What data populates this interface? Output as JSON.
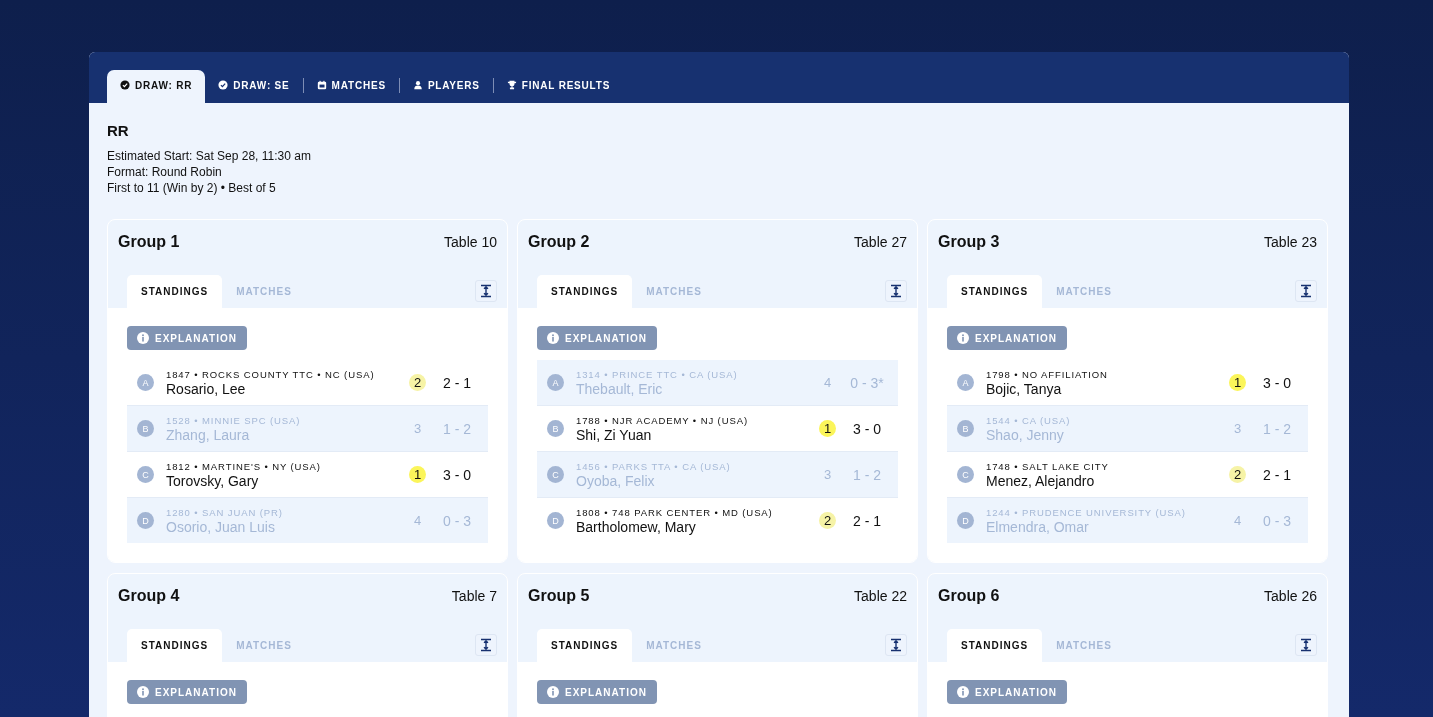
{
  "tabs": [
    {
      "label": "DRAW: RR",
      "selected": true
    },
    {
      "label": "DRAW: SE",
      "selected": false
    },
    {
      "label": "MATCHES",
      "selected": false
    },
    {
      "label": "PLAYERS",
      "selected": false
    },
    {
      "label": "FINAL RESULTS",
      "selected": false
    }
  ],
  "event": {
    "title": "RR",
    "lines": [
      "Estimated Start: Sat Sep 28, 11:30 am",
      "Format: Round Robin",
      "First to 11 (Win by 2) • Best of 5"
    ]
  },
  "groups": [
    {
      "name": "Group 1",
      "table": "Table 10",
      "tabs": [
        {
          "label": "STANDINGS",
          "selected": true
        },
        {
          "label": "MATCHES",
          "selected": false
        }
      ],
      "explanation": "EXPLANATION",
      "players": [
        {
          "seed": "A",
          "info": "1847 • ROCKS COUNTY TTC • NC (USA)",
          "name": "Rosario, Lee",
          "rank": "2",
          "record": "2 - 1",
          "advancing": true,
          "color": "#f6f3a6"
        },
        {
          "seed": "B",
          "info": "1528 • MINNIE SPC (USA)",
          "name": "Zhang, Laura",
          "rank": "3",
          "record": "1 - 2",
          "advancing": false
        },
        {
          "seed": "C",
          "info": "1812 • MARTINE'S • NY (USA)",
          "name": "Torovsky, Gary",
          "rank": "1",
          "record": "3 - 0",
          "advancing": true,
          "color": "#fbf55a"
        },
        {
          "seed": "D",
          "info": "1280 • SAN JUAN (PR)",
          "name": "Osorio, Juan Luis",
          "rank": "4",
          "record": "0 - 3",
          "advancing": false
        }
      ]
    },
    {
      "name": "Group 2",
      "table": "Table 27",
      "tabs": [
        {
          "label": "STANDINGS",
          "selected": true
        },
        {
          "label": "MATCHES",
          "selected": false
        }
      ],
      "explanation": "EXPLANATION",
      "players": [
        {
          "seed": "A",
          "info": "1314 • PRINCE TTC • CA (USA)",
          "name": "Thebault, Eric",
          "rank": "4",
          "record": "0 - 3*",
          "advancing": false
        },
        {
          "seed": "B",
          "info": "1788 • NJR ACADEMY • NJ (USA)",
          "name": "Shi, Zi Yuan",
          "rank": "1",
          "record": "3 - 0",
          "advancing": true,
          "color": "#fbf55a"
        },
        {
          "seed": "C",
          "info": "1456 • PARKS TTA • CA (USA)",
          "name": "Oyoba, Felix",
          "rank": "3",
          "record": "1 - 2",
          "advancing": false
        },
        {
          "seed": "D",
          "info": "1808 • 748 PARK CENTER • MD (USA)",
          "name": "Bartholomew, Mary",
          "rank": "2",
          "record": "2 - 1",
          "advancing": true,
          "color": "#f6f3a6"
        }
      ]
    },
    {
      "name": "Group 3",
      "table": "Table 23",
      "tabs": [
        {
          "label": "STANDINGS",
          "selected": true
        },
        {
          "label": "MATCHES",
          "selected": false
        }
      ],
      "explanation": "EXPLANATION",
      "players": [
        {
          "seed": "A",
          "info": "1798 • NO AFFILIATION",
          "name": "Bojic, Tanya",
          "rank": "1",
          "record": "3 - 0",
          "advancing": true,
          "color": "#fbf55a"
        },
        {
          "seed": "B",
          "info": "1544 • CA (USA)",
          "name": "Shao, Jenny",
          "rank": "3",
          "record": "1 - 2",
          "advancing": false
        },
        {
          "seed": "C",
          "info": "1748 • SALT LAKE CITY",
          "name": "Menez, Alejandro",
          "rank": "2",
          "record": "2 - 1",
          "advancing": true,
          "color": "#f6f3a6"
        },
        {
          "seed": "D",
          "info": "1244 • PRUDENCE UNIVERSITY (USA)",
          "name": "Elmendra, Omar",
          "rank": "4",
          "record": "0 - 3",
          "advancing": false
        }
      ]
    },
    {
      "name": "Group 4",
      "table": "Table 7",
      "tabs": [
        {
          "label": "STANDINGS",
          "selected": true
        },
        {
          "label": "MATCHES",
          "selected": false
        }
      ],
      "explanation": "EXPLANATION"
    },
    {
      "name": "Group 5",
      "table": "Table 22",
      "tabs": [
        {
          "label": "STANDINGS",
          "selected": true
        },
        {
          "label": "MATCHES",
          "selected": false
        }
      ],
      "explanation": "EXPLANATION"
    },
    {
      "name": "Group 6",
      "table": "Table 26",
      "tabs": [
        {
          "label": "STANDINGS",
          "selected": true
        },
        {
          "label": "MATCHES",
          "selected": false
        }
      ],
      "explanation": "EXPLANATION"
    }
  ]
}
